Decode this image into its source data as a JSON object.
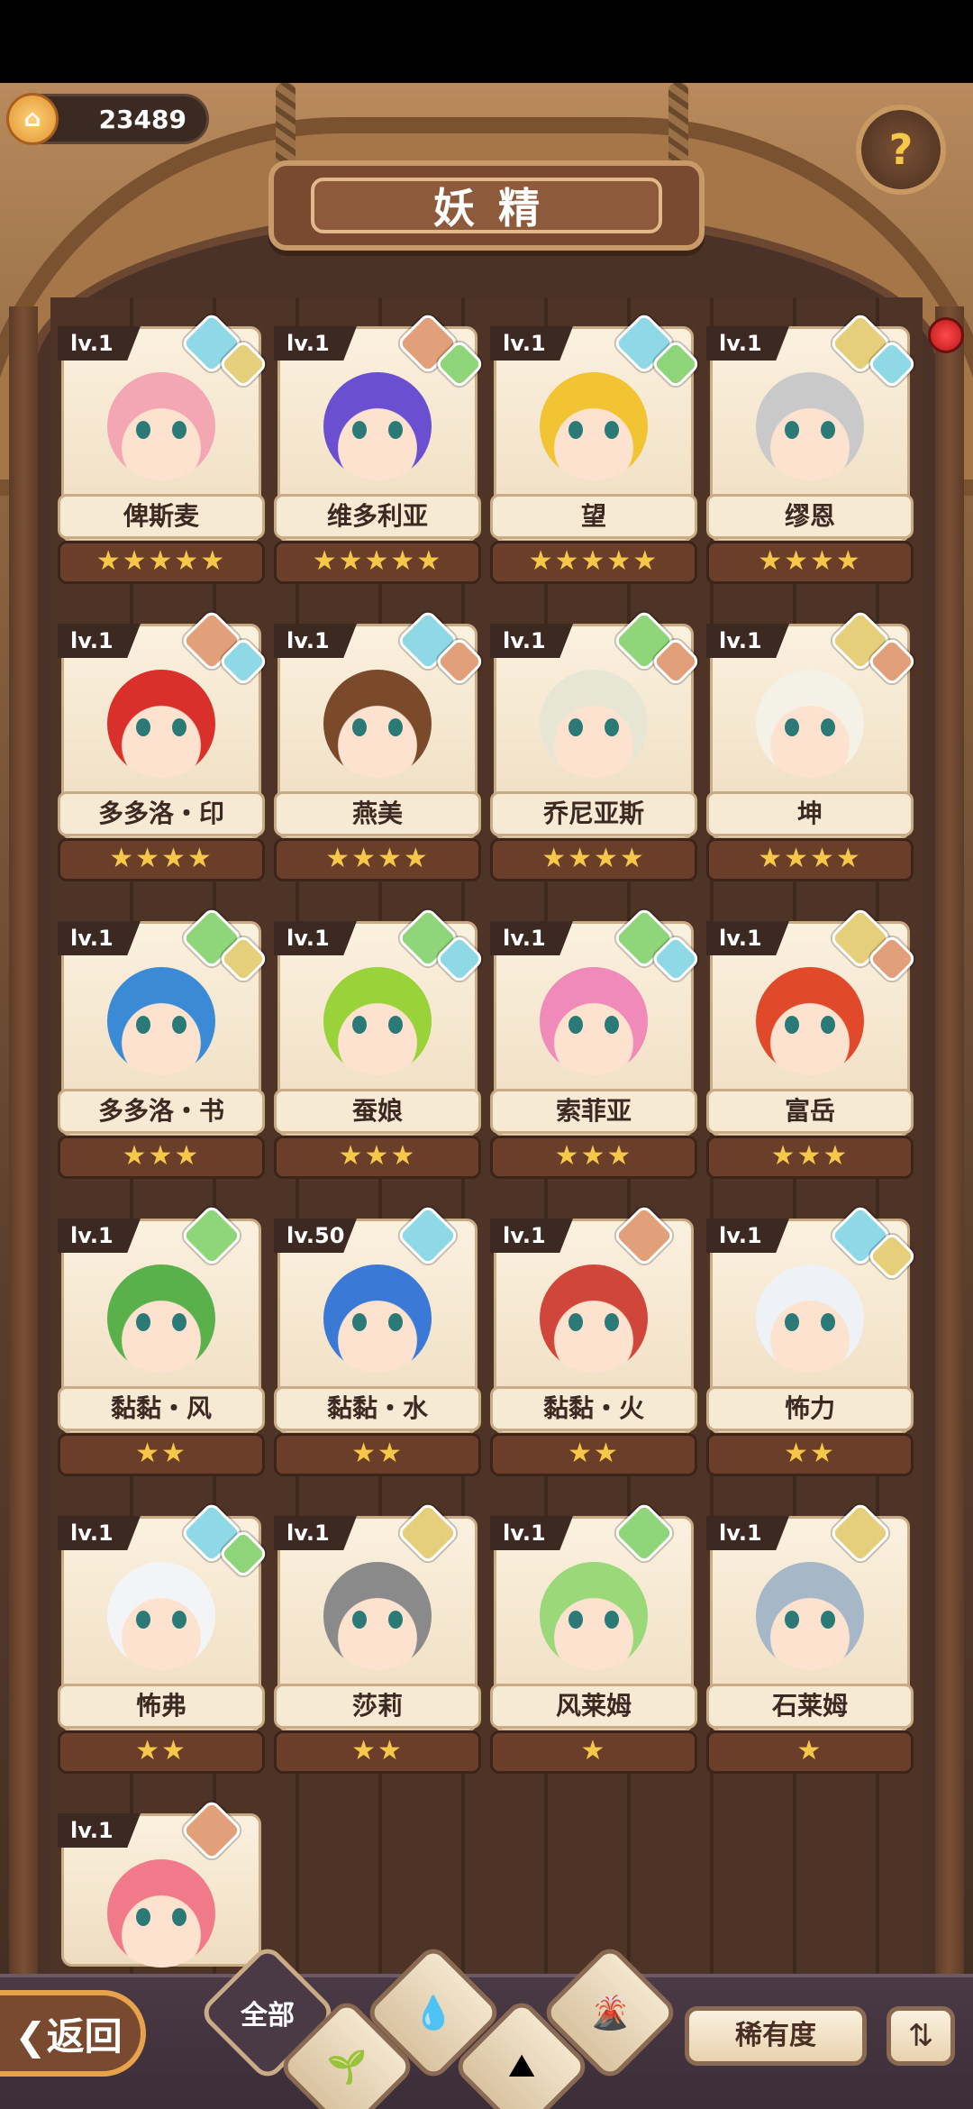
{
  "header": {
    "currency_value": "23489",
    "title": "妖精"
  },
  "fairies": [
    {
      "level": "lv.1",
      "name": "俾斯麦",
      "stars": "★★★★★",
      "badge1": "water",
      "badge2": "earth",
      "hair": "#f3a7b3"
    },
    {
      "level": "lv.1",
      "name": "维多利亚",
      "stars": "★★★★★",
      "badge1": "fire",
      "badge2": "wind",
      "hair": "#6a4fd0"
    },
    {
      "level": "lv.1",
      "name": "望",
      "stars": "★★★★★",
      "badge1": "water",
      "badge2": "wind",
      "hair": "#f2c434"
    },
    {
      "level": "lv.1",
      "name": "缪恩",
      "stars": "★★★★",
      "badge1": "earth",
      "badge2": "water",
      "hair": "#c9c9c9"
    },
    {
      "level": "lv.1",
      "name": "多多洛・印",
      "stars": "★★★★",
      "badge1": "fire",
      "badge2": "water",
      "hair": "#d9302c"
    },
    {
      "level": "lv.1",
      "name": "燕美",
      "stars": "★★★★",
      "badge1": "water",
      "badge2": "fire",
      "hair": "#7a4a2a"
    },
    {
      "level": "lv.1",
      "name": "乔尼亚斯",
      "stars": "★★★★",
      "badge1": "wind",
      "badge2": "fire",
      "hair": "#e7e6d4"
    },
    {
      "level": "lv.1",
      "name": "坤",
      "stars": "★★★★",
      "badge1": "earth",
      "badge2": "fire",
      "hair": "#f4f1e6"
    },
    {
      "level": "lv.1",
      "name": "多多洛・书",
      "stars": "★★★",
      "badge1": "wind",
      "badge2": "earth",
      "hair": "#3a8ad6"
    },
    {
      "level": "lv.1",
      "name": "蚕娘",
      "stars": "★★★",
      "badge1": "wind",
      "badge2": "water",
      "hair": "#9ad23a"
    },
    {
      "level": "lv.1",
      "name": "索菲亚",
      "stars": "★★★",
      "badge1": "wind",
      "badge2": "water",
      "hair": "#f08ab8"
    },
    {
      "level": "lv.1",
      "name": "富岳",
      "stars": "★★★",
      "badge1": "earth",
      "badge2": "fire",
      "hair": "#e04a2a"
    },
    {
      "level": "lv.1",
      "name": "黏黏・风",
      "stars": "★★",
      "badge1": "wind",
      "badge2": "",
      "hair": "#5ab04a"
    },
    {
      "level": "lv.50",
      "name": "黏黏・水",
      "stars": "★★",
      "badge1": "water",
      "badge2": "",
      "hair": "#3a7ad6"
    },
    {
      "level": "lv.1",
      "name": "黏黏・火",
      "stars": "★★",
      "badge1": "fire",
      "badge2": "",
      "hair": "#d0463a"
    },
    {
      "level": "lv.1",
      "name": "怖力",
      "stars": "★★",
      "badge1": "water",
      "badge2": "earth",
      "hair": "#eef2f6"
    },
    {
      "level": "lv.1",
      "name": "怖弗",
      "stars": "★★",
      "badge1": "water",
      "badge2": "wind",
      "hair": "#f2f4f6"
    },
    {
      "level": "lv.1",
      "name": "莎莉",
      "stars": "★★",
      "badge1": "earth",
      "badge2": "",
      "hair": "#8a8a8a"
    },
    {
      "level": "lv.1",
      "name": "风莱姆",
      "stars": "★",
      "badge1": "wind",
      "badge2": "",
      "hair": "#9ad87a"
    },
    {
      "level": "lv.1",
      "name": "石莱姆",
      "stars": "★",
      "badge1": "earth",
      "badge2": "",
      "hair": "#a6b8c8"
    },
    {
      "level": "lv.1",
      "name": "",
      "stars": "",
      "badge1": "fire",
      "badge2": "",
      "hair": "#f07a8a"
    }
  ],
  "badge_colors": {
    "water": "#8fd8e6",
    "wind": "#8fd67a",
    "earth": "#e6cf7a",
    "fire": "#e2a07a"
  },
  "footer": {
    "back_label": "❮返回",
    "filter_all_label": "全部",
    "sort_label": "稀有度",
    "order_icon": "⇅"
  }
}
